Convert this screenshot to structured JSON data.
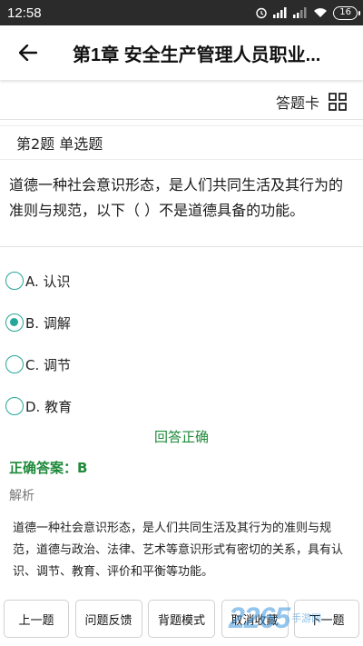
{
  "statusbar": {
    "time": "12:58",
    "battery": "16"
  },
  "appbar": {
    "title": "第1章 安全生产管理人员职业..."
  },
  "answer_card": {
    "label": "答题卡"
  },
  "question": {
    "type_label": "第2题 单选题",
    "text": "道德一种社会意识形态，是人们共同生活及其行为的准则与规范，以下（ ）不是道德具备的功能。"
  },
  "options": [
    {
      "label": "A. 认识",
      "selected": false
    },
    {
      "label": "B. 调解",
      "selected": true
    },
    {
      "label": "C. 调节",
      "selected": false
    },
    {
      "label": "D. 教育",
      "selected": false
    }
  ],
  "result": {
    "status": "回答正确",
    "correct_answer": "正确答案：B",
    "analysis_label": "解析",
    "analysis_text": "道德一种社会意识形态，是人们共同生活及其行为的准则与规范，道德与政治、法律、艺术等意识形式有密切的关系，具有认识、调节、教育、评价和平衡等功能。"
  },
  "bottom_buttons": {
    "prev": "上一题",
    "feedback": "问题反馈",
    "recite_mode": "背题模式",
    "unfavorite": "取消收藏",
    "next": "下一题"
  },
  "watermark": {
    "main": "2265",
    "sub": "手游网"
  },
  "colors": {
    "accent": "#26a69a",
    "correct": "#1e8a3a",
    "statusbar": "#2b2b2b"
  }
}
